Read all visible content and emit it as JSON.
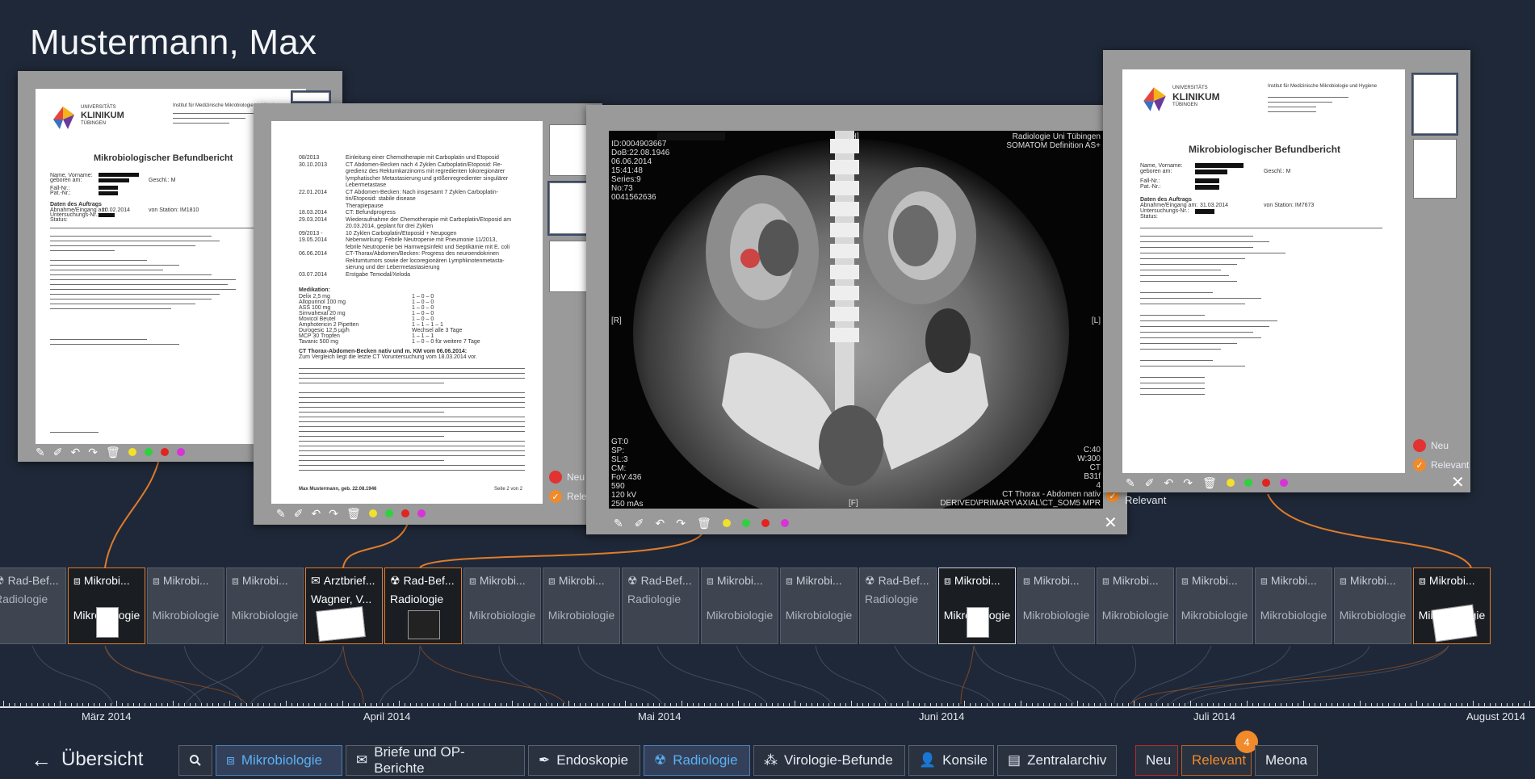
{
  "patient": {
    "name": "Mustermann, Max"
  },
  "doc1": {
    "institute": "Institut für Medizinische Mikrobiologie und Hygiene",
    "logo_line1": "UNIVERSITÄTS",
    "logo_line2": "KLINIKUM",
    "logo_line3": "TÜBINGEN",
    "heading": "Mikrobiologischer Befundbericht",
    "labels": [
      "Name, Vorname:",
      "geboren am:",
      "Fall-Nr.:",
      "Pat.-Nr.:",
      "Daten des Auftrags",
      "Abnahme/Eingang am:",
      "Untersuchungs-Nr.:",
      "Status:"
    ],
    "geschl": "Geschl.: M",
    "date": "10.02.2014",
    "station": "von Station: IM1810"
  },
  "doc2": {
    "timeline": [
      {
        "d": "08/2013",
        "t": "Einleitung einer Chemotherapie mit Carboplatin und Etoposid"
      },
      {
        "d": "30.10.2013",
        "t": "CT Abdomen-Becken nach 4 Zyklen Carboplatin/Etoposid: Re-"
      },
      {
        "d": "",
        "t": "gredienz des Rektumkarzinoms mit regredienten lokoregionärer"
      },
      {
        "d": "",
        "t": "lymphatischer Metastasierung und größenregredienter singulärer"
      },
      {
        "d": "",
        "t": "Lebermetastase"
      },
      {
        "d": "22.01.2014",
        "t": "CT Abdomen-Becken: Nach insgesamt 7 Zyklen Carboplatin-"
      },
      {
        "d": "",
        "t": "tin/Etoposid: stabile disease"
      },
      {
        "d": "",
        "t": "Therapiepause"
      },
      {
        "d": "18.03.2014",
        "t": "CT: Befundprogress"
      },
      {
        "d": "29.03.2014",
        "t": "Wiederaufnahme der Chemotherapie mit Carboplatin/Etoposid am"
      },
      {
        "d": "",
        "t": "20.03.2014, geplant für drei Zyklen"
      },
      {
        "d": "09/2013 -",
        "t": "10 Zyklen Carboplatin/Etoposid + Neupogen"
      },
      {
        "d": "19.05.2014",
        "t": "Nebenwirkung: Febrile Neutropenie mit Pneumonie 11/2013,"
      },
      {
        "d": "",
        "t": "febrile Neutropenie bei Harnwegsinfekt und Septikämie mit E. coli"
      },
      {
        "d": "06.06.2014",
        "t": "CT-Thorax/Abdomen/Becken: Progress des neuroendokrinen"
      },
      {
        "d": "",
        "t": "Rektumtumors sowie der locoregionären Lymphknotenmetasta-"
      },
      {
        "d": "",
        "t": "sierung und der Lebermetastasierung"
      },
      {
        "d": "03.07.2014",
        "t": "Erstgabe Temodal/Xeloda"
      }
    ],
    "medication_title": "Medikation:",
    "medication": [
      {
        "n": "Delix 2,5 mg",
        "s": "1 – 0 – 0"
      },
      {
        "n": "Allopurinol 100 mg",
        "s": "1 – 0 – 0"
      },
      {
        "n": "ASS 100 mg",
        "s": "1 – 0 – 0"
      },
      {
        "n": "Simvahexal 20 mg",
        "s": "1 – 0 – 0"
      },
      {
        "n": "Movicol Beutel",
        "s": "1 – 0 – 0"
      },
      {
        "n": "Amphotericin 2 Pipetten",
        "s": "1 – 1 – 1 – 1"
      },
      {
        "n": "Durogesic 12,5 µg/h",
        "s": "Wechsel alle 3 Tage"
      },
      {
        "n": "MCP 30 Tropfen",
        "s": "1 – 1 – 1"
      },
      {
        "n": "Tavanic 500 mg",
        "s": "1 – 0 – 0 für weitere 7 Tage"
      }
    ],
    "ct_heading": "CT Thorax-Abdomen-Becken nativ und m. KM vom 06.06.2014:",
    "ct_compare": "Zum Vergleich liegt die letzte CT Voruntersuchung vom 18.03.2014 vor.",
    "footer_name": "Max Mustermann, geb. 22.08.1946",
    "footer_page": "Seite 2 von 2"
  },
  "ct": {
    "id": "ID:0004903667",
    "dob": "DoB:22.08.1946",
    "date": "06.06.2014",
    "time": "15:41:48",
    "series": "Series:9",
    "no": "No:73",
    "acc": "0041562636",
    "site": "Radiologie Uni Tübingen",
    "scanner": "SOMATOM Definition AS+",
    "left_marker": "[R]",
    "right_marker": "[L]",
    "top_marker": "[H]",
    "bottom_marker": "[F]",
    "bl": "GT:0\nSP:\nSL:3\nCM:\nFoV:436\n590\n120 kV\n250 mAs",
    "br": "C:40\nW:300\nCT\nB31f\n4\nCT Thorax - Abdomen nativ\nDERIVED\\PRIMARY\\AXIAL\\CT_SOM5 MPR"
  },
  "doc4": {
    "institute": "Institut für Medizinische Mikrobiologie und Hygiene",
    "heading": "Mikrobiologischer Befundbericht",
    "geschl": "Geschl.: M",
    "date": "31.03.2014",
    "station": "von Station: IM7673"
  },
  "legend": {
    "neu": "Neu",
    "relevant": "Relevant"
  },
  "cards": [
    {
      "title": "Rad-Bef...",
      "sub": "Radiologie",
      "icon": "radiation-icon",
      "active": false
    },
    {
      "title": "Mikrobi...",
      "sub": "Mikrobiologie",
      "icon": "microscope-icon",
      "active": true
    },
    {
      "title": "Mikrobi...",
      "sub": "Mikrobiologie",
      "icon": "microscope-icon",
      "active": false
    },
    {
      "title": "Mikrobi...",
      "sub": "Mikrobiologie",
      "icon": "microscope-icon",
      "active": false
    },
    {
      "title": "Arztbrief...",
      "sub": "Wagner, V...",
      "icon": "envelope-icon",
      "active": true
    },
    {
      "title": "Rad-Bef...",
      "sub": "Radiologie",
      "icon": "radiation-icon",
      "active": true
    },
    {
      "title": "Mikrobi...",
      "sub": "Mikrobiologie",
      "icon": "microscope-icon",
      "active": false
    },
    {
      "title": "Mikrobi...",
      "sub": "Mikrobiologie",
      "icon": "microscope-icon",
      "active": false
    },
    {
      "title": "Rad-Bef...",
      "sub": "Radiologie",
      "icon": "radiation-icon",
      "active": false
    },
    {
      "title": "Mikrobi...",
      "sub": "Mikrobiologie",
      "icon": "microscope-icon",
      "active": false
    },
    {
      "title": "Mikrobi...",
      "sub": "Mikrobiologie",
      "icon": "microscope-icon",
      "active": false
    },
    {
      "title": "Rad-Bef...",
      "sub": "Radiologie",
      "icon": "radiation-icon",
      "active": false
    },
    {
      "title": "Mikrobi...",
      "sub": "Mikrobiologie",
      "icon": "microscope-icon",
      "active": true
    },
    {
      "title": "Mikrobi...",
      "sub": "Mikrobiologie",
      "icon": "microscope-icon",
      "active": false
    },
    {
      "title": "Mikrobi...",
      "sub": "Mikrobiologie",
      "icon": "microscope-icon",
      "active": false
    },
    {
      "title": "Mikrobi...",
      "sub": "Mikrobiologie",
      "icon": "microscope-icon",
      "active": false
    },
    {
      "title": "Mikrobi...",
      "sub": "Mikrobiologie",
      "icon": "microscope-icon",
      "active": false
    },
    {
      "title": "Mikrobi...",
      "sub": "Mikrobiologie",
      "icon": "microscope-icon",
      "active": false
    },
    {
      "title": "Mikrobi...",
      "sub": "Mikrobiologie",
      "icon": "microscope-icon",
      "active": true
    }
  ],
  "months": [
    "März 2014",
    "April 2014",
    "Mai 2014",
    "Juni 2014",
    "Juli 2014",
    "August 2014"
  ],
  "nav": {
    "back_label": "Übersicht",
    "filters": [
      "Mikrobiologie",
      "Briefe und OP-Berichte",
      "Endoskopie",
      "Radiologie",
      "Virologie-Befunde",
      "Konsile",
      "Zentralarchiv"
    ],
    "flags": [
      "Neu",
      "Relevant",
      "Meona"
    ],
    "relevant_count": "4"
  },
  "colors": {
    "accent_blue": "#5ab1f2",
    "relevant_orange": "#f08a2a",
    "neu_red": "#e33232",
    "background": "#1f2838"
  },
  "toolbar_dot_colors": [
    "#f1e12c",
    "#2fd13f",
    "#e0241f",
    "#d833d8"
  ]
}
